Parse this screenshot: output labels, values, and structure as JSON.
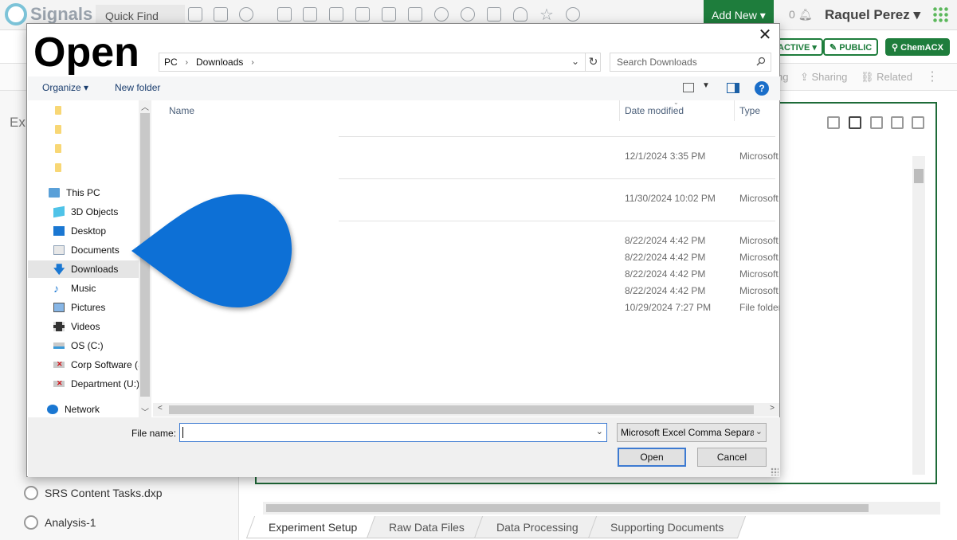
{
  "app": {
    "brand": "Signals",
    "quick_find": "Quick Find",
    "add_new": "Add New",
    "notifications": "0",
    "user": "Raquel Perez",
    "pills": {
      "active": "ACTIVE",
      "public": "PUBLIC",
      "chemacx": "ChemACX"
    },
    "toolbar": {
      "sharing": "Sharing",
      "related": "Related",
      "partial": "ng"
    },
    "left_title": "Exp",
    "left_items": [
      "SRS Content Tasks.dxp",
      "Analysis-1"
    ],
    "tabs": [
      "Experiment Setup",
      "Raw Data Files",
      "Data Processing",
      "Supporting Documents"
    ],
    "brand_color": "#1e7d3c"
  },
  "dialog": {
    "title": "Open",
    "breadcrumb": [
      "PC",
      "Downloads"
    ],
    "search_placeholder": "Search Downloads",
    "organize": "Organize",
    "new_folder": "New folder",
    "help": "?",
    "nav": {
      "quick_access_folders": [
        "",
        "",
        "",
        ""
      ],
      "this_pc": "This PC",
      "items": [
        "3D Objects",
        "Desktop",
        "Documents",
        "Downloads",
        "Music",
        "Pictures",
        "Videos",
        "OS (C:)",
        "Corp Software (S",
        "Department (U:)"
      ],
      "network": "Network"
    },
    "columns": {
      "name": "Name",
      "date_modified": "Date modified",
      "type": "Type"
    },
    "files": [
      {
        "date": "12/1/2024 3:35 PM",
        "type": "Microsoft"
      },
      {
        "date": "11/30/2024 10:02 PM",
        "type": "Microsoft"
      },
      {
        "date": "8/22/2024 4:42 PM",
        "type": "Microsoft"
      },
      {
        "date": "8/22/2024 4:42 PM",
        "type": "Microsoft"
      },
      {
        "date": "8/22/2024 4:42 PM",
        "type": "Microsoft"
      },
      {
        "date": "8/22/2024 4:42 PM",
        "type": "Microsoft"
      },
      {
        "date": "10/29/2024 7:27 PM",
        "type": "File folder"
      }
    ],
    "file_name_label": "File name:",
    "file_name_value": "",
    "file_type": "Microsoft Excel Comma Separa",
    "open_button": "Open",
    "cancel_button": "Cancel",
    "pointer_color": "#0b6fd6"
  }
}
